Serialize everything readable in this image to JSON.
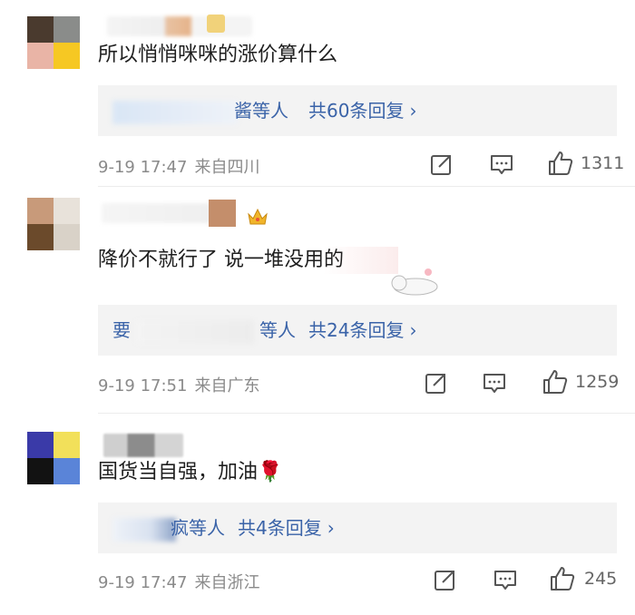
{
  "comments": [
    {
      "text": "所以悄悄咪咪的涨价算什么",
      "reply_suffix": "酱等人",
      "reply_count": "共60条回复",
      "time": "9-19 17:47",
      "location": "来自四川",
      "likes": "1311",
      "avatar_colors": [
        "#4a3a2e",
        "#8a8c8a",
        "#e9b4a6",
        "#f6c823"
      ]
    },
    {
      "text": "降价不就行了 说一堆没用的",
      "reply_prefix": "要",
      "reply_suffix": "等人",
      "reply_count": "共24条回复",
      "time": "9-19 17:51",
      "location": "来自广东",
      "likes": "1259",
      "avatar_colors": [
        "#c89a7a",
        "#e8e2da",
        "#6b4a2b",
        "#d9d2c8"
      ]
    },
    {
      "text": "国货当自强，加油🌹",
      "reply_suffix": "疯等人",
      "reply_count": "共4条回复",
      "time": "9-19 17:47",
      "location": "来自浙江",
      "likes": "245",
      "avatar_colors": [
        "#3a3aa8",
        "#f2e05a",
        "#121212",
        "#5a84d8"
      ]
    }
  ],
  "icons": {
    "share": "share-icon",
    "comment": "comment-icon",
    "like": "like-icon",
    "chevron": "chevron-right-icon"
  },
  "colors": {
    "link": "#3a63a8",
    "meta": "#8a8a8a",
    "reply_bg": "#f3f3f3"
  }
}
